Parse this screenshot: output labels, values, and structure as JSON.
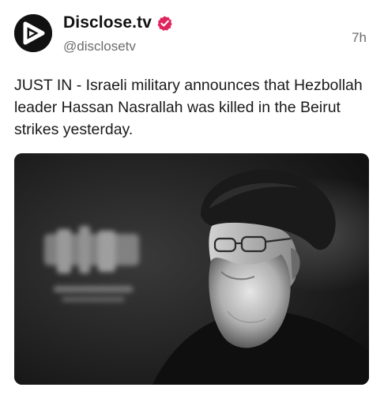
{
  "post": {
    "author": {
      "display_name": "Disclose.tv",
      "handle": "@disclosetv",
      "avatar_icon": "disclose-play-logo-icon",
      "verified_icon": "verified-badge-icon",
      "verified_color": "#e0245e"
    },
    "timestamp": "7h",
    "text": "JUST IN - Israeli military announces that Hezbollah leader Hassan Nasrallah was killed in the Beirut strikes yesterday.",
    "media": {
      "type": "photo",
      "style": "black-and-white"
    }
  }
}
